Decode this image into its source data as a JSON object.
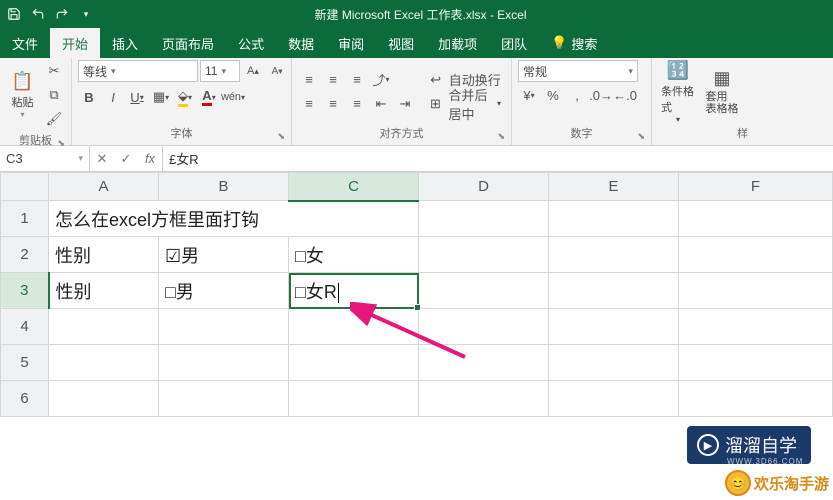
{
  "titlebar": {
    "title": "新建 Microsoft Excel 工作表.xlsx - Excel"
  },
  "tabs": {
    "file": "文件",
    "items": [
      "开始",
      "插入",
      "页面布局",
      "公式",
      "数据",
      "审阅",
      "视图",
      "加载项",
      "团队"
    ],
    "active_index": 0,
    "search_placeholder": "搜索"
  },
  "ribbon": {
    "clipboard": {
      "paste": "粘贴",
      "label": "剪贴板"
    },
    "font": {
      "name": "等线",
      "size": "11",
      "label": "字体",
      "bold": "B",
      "italic": "I",
      "underline": "U"
    },
    "alignment": {
      "label": "对齐方式",
      "wrap": "自动换行",
      "merge": "合并后居中"
    },
    "number": {
      "label": "数字",
      "format": "常规"
    },
    "styles": {
      "cond": "条件格式",
      "table": "套用\n表格格",
      "label": "样"
    }
  },
  "formula_bar": {
    "name_box": "C3",
    "formula": "£女R"
  },
  "columns": [
    "A",
    "B",
    "C",
    "D",
    "E",
    "F"
  ],
  "rows": [
    {
      "n": "1",
      "cells": [
        "怎么在excel方框里面打钩",
        "",
        "",
        "",
        "",
        ""
      ]
    },
    {
      "n": "2",
      "cells": [
        "性别",
        "☑男",
        "□女",
        "",
        "",
        ""
      ]
    },
    {
      "n": "3",
      "cells": [
        "性别",
        "□男",
        "□女R",
        "",
        "",
        ""
      ]
    },
    {
      "n": "4",
      "cells": [
        "",
        "",
        "",
        "",
        "",
        ""
      ]
    },
    {
      "n": "5",
      "cells": [
        "",
        "",
        "",
        "",
        "",
        ""
      ]
    },
    {
      "n": "6",
      "cells": [
        "",
        "",
        "",
        "",
        "",
        ""
      ]
    }
  ],
  "active": {
    "row_index": 2,
    "col_index": 2
  },
  "watermark1": {
    "text": "溜溜自学",
    "sub": "WWW.3D66.COM"
  },
  "watermark2": {
    "text": "欢乐淘手游"
  }
}
